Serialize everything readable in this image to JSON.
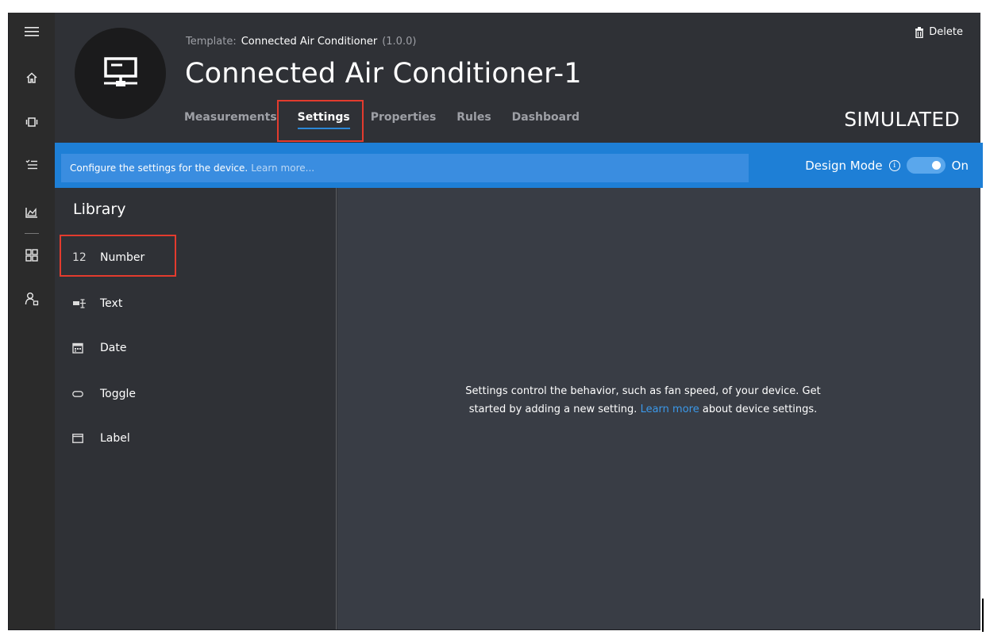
{
  "header": {
    "template_label": "Template:",
    "template_name": "Connected Air Conditioner",
    "template_version": "(1.0.0)",
    "device_title": "Connected Air Conditioner-1",
    "delete_label": "Delete",
    "status": "SIMULATED",
    "tabs": [
      {
        "label": "Measurements"
      },
      {
        "label": "Settings"
      },
      {
        "label": "Properties"
      },
      {
        "label": "Rules"
      },
      {
        "label": "Dashboard"
      }
    ],
    "active_tab": "Settings"
  },
  "infobar": {
    "message": "Configure the settings for the device.",
    "learn_more": "Learn more...",
    "design_mode_label": "Design Mode",
    "toggle_state": "On"
  },
  "library": {
    "title": "Library",
    "items": [
      {
        "label": "Number",
        "icon": "number-icon",
        "glyph": "12"
      },
      {
        "label": "Text",
        "icon": "text-icon"
      },
      {
        "label": "Date",
        "icon": "calendar-icon"
      },
      {
        "label": "Toggle",
        "icon": "toggle-icon"
      },
      {
        "label": "Label",
        "icon": "label-icon"
      }
    ]
  },
  "main": {
    "empty_text_1": "Settings control the behavior, such as fan speed, of your device. Get started by adding a new setting.",
    "empty_link_1": "Learn more",
    "empty_text_2": "about device settings."
  },
  "rail": {
    "icons": [
      "menu-icon",
      "home-icon",
      "devices-icon",
      "rules-icon",
      "analytics-icon",
      "dashboard-icon",
      "admin-icon"
    ]
  },
  "colors": {
    "accent": "#1e7fd6",
    "highlight": "#e33b2e",
    "link": "#3b98e8"
  }
}
